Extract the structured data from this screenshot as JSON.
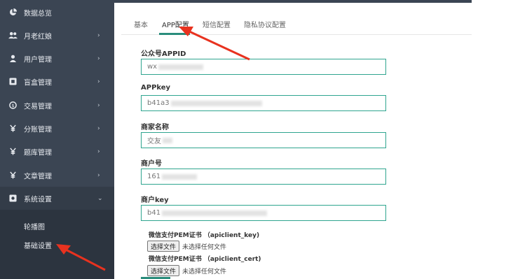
{
  "sidebar": {
    "items": [
      {
        "label": "数据总览",
        "icon": "pie-chart-icon",
        "has_children": false
      },
      {
        "label": "月老红娘",
        "icon": "users-icon",
        "has_children": true
      },
      {
        "label": "用户管理",
        "icon": "user-icon",
        "has_children": true
      },
      {
        "label": "盲盒管理",
        "icon": "box-icon",
        "has_children": true
      },
      {
        "label": "交易管理",
        "icon": "coin-icon",
        "has_children": true
      },
      {
        "label": "分账管理",
        "icon": "yen-icon",
        "has_children": true
      },
      {
        "label": "题库管理",
        "icon": "yen-icon",
        "has_children": true
      },
      {
        "label": "文章管理",
        "icon": "yen-icon",
        "has_children": true
      },
      {
        "label": "系统设置",
        "icon": "settings-square-icon",
        "has_children": true,
        "expanded": true
      }
    ],
    "chevron_right": "›",
    "chevron_down": "⌄",
    "submenu": [
      {
        "label": "轮播图"
      },
      {
        "label": "基础设置",
        "active": true
      }
    ]
  },
  "tabs": [
    {
      "label": "基本"
    },
    {
      "label": "APP配置",
      "active": true
    },
    {
      "label": "短信配置"
    },
    {
      "label": "隐私协议配置"
    }
  ],
  "form": {
    "fields": [
      {
        "label": "公众号APPID",
        "value": "wx"
      },
      {
        "label": "APPkey",
        "value": "b41a3"
      },
      {
        "label": "商家名称",
        "value": "交友"
      },
      {
        "label": "商户号",
        "value": "161"
      },
      {
        "label": "商户key",
        "value": "b41"
      }
    ],
    "certs": [
      {
        "label": "微信支付PEM证书 （apiclient_key)",
        "button": "选择文件",
        "status": "未选择任何文件"
      },
      {
        "label": "微信支付PEM证书 （apiclient_cert)",
        "button": "选择文件",
        "status": "未选择任何文件"
      }
    ]
  },
  "colors": {
    "sidebar_bg": "#3b4553",
    "accent": "#2a8d7c",
    "input_border": "#2fa58f",
    "annotation_arrow": "#e8321f"
  }
}
